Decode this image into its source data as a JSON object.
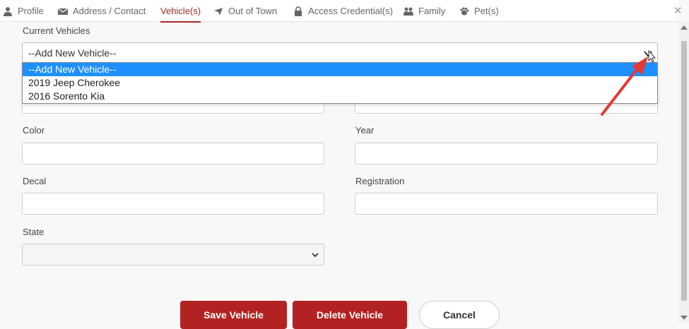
{
  "tabs": [
    {
      "label": "Profile",
      "icon": "user-icon"
    },
    {
      "label": "Address / Contact",
      "icon": "envelope-icon"
    },
    {
      "label": "Vehicle(s)",
      "icon": "",
      "active": true
    },
    {
      "label": "Out of Town",
      "icon": "plane-icon"
    },
    {
      "label": "Access Credential(s)",
      "icon": "lock-icon"
    },
    {
      "label": "Family",
      "icon": "users-icon"
    },
    {
      "label": "Pet(s)",
      "icon": "paw-icon"
    }
  ],
  "close_glyph": "✕",
  "form": {
    "current_vehicles_label": "Current Vehicles",
    "current_vehicles_value": "--Add New Vehicle--",
    "dropdown_options": [
      "--Add New Vehicle--",
      "2019 Jeep Cherokee",
      "2016 Sorento Kia"
    ],
    "color_label": "Color",
    "year_label": "Year",
    "decal_label": "Decal",
    "registration_label": "Registration",
    "state_label": "State",
    "color_value": "",
    "year_value": "",
    "decal_value": "",
    "registration_value": "",
    "state_value": ""
  },
  "buttons": {
    "save": "Save Vehicle",
    "delete": "Delete Vehicle",
    "cancel": "Cancel"
  },
  "colors": {
    "accent": "#a52a2a",
    "button_red": "#b22222",
    "dropdown_highlight": "#1e90ff",
    "annotation_arrow": "#e53935"
  }
}
